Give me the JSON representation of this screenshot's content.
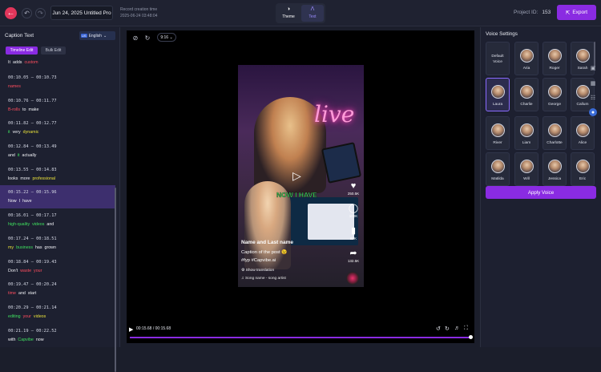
{
  "topbar": {
    "project_title": "Jun 24, 2025 Untitled Pro",
    "record_label": "Record creation time",
    "record_time": "2025-06-24 03:48:04",
    "modes": [
      {
        "label": "Theme"
      },
      {
        "label": "Text"
      }
    ],
    "project_id_label": "Project ID:",
    "project_id": "153",
    "export_label": "Export"
  },
  "left": {
    "title": "Caption Text",
    "language": {
      "flag": "US",
      "label": "English"
    },
    "tabs": [
      {
        "label": "Timeline Edit"
      },
      {
        "label": "Bulk Edit"
      }
    ],
    "first_partial": [
      {
        "t": "It",
        "c": "w"
      },
      {
        "t": "adds",
        "c": "w"
      },
      {
        "t": "custom",
        "c": "r"
      }
    ],
    "captions": [
      {
        "time": "00:10.05 – 00:10.73",
        "words": [
          {
            "t": "names",
            "c": "r"
          }
        ]
      },
      {
        "time": "00:10.76 – 00:11.77",
        "words": [
          {
            "t": "B-rolls",
            "c": "r"
          },
          {
            "t": "to",
            "c": "w"
          },
          {
            "t": "make",
            "c": "w"
          }
        ]
      },
      {
        "time": "00:11.82 – 00:12.77",
        "words": [
          {
            "t": "it",
            "c": "g"
          },
          {
            "t": "very",
            "c": "w"
          },
          {
            "t": "dynamic",
            "c": "y"
          }
        ]
      },
      {
        "time": "00:12.84 – 00:13.49",
        "words": [
          {
            "t": "and",
            "c": "w"
          },
          {
            "t": "it",
            "c": "g"
          },
          {
            "t": "actually",
            "c": "w"
          }
        ]
      },
      {
        "time": "00:13.55 – 00:14.83",
        "words": [
          {
            "t": "looks",
            "c": "w"
          },
          {
            "t": "more",
            "c": "w"
          },
          {
            "t": "professional",
            "c": "y"
          }
        ]
      },
      {
        "time": "00:15.22 – 00:15.96",
        "words": [
          {
            "t": "Now",
            "c": "w"
          },
          {
            "t": "I",
            "c": "w"
          },
          {
            "t": "have",
            "c": "w"
          }
        ],
        "active": true
      },
      {
        "time": "00:16.01 – 00:17.17",
        "words": [
          {
            "t": "high-quality",
            "c": "g"
          },
          {
            "t": "videos",
            "c": "g"
          },
          {
            "t": "and",
            "c": "w"
          }
        ]
      },
      {
        "time": "00:17.24 – 00:18.51",
        "words": [
          {
            "t": "my",
            "c": "y"
          },
          {
            "t": "business",
            "c": "g"
          },
          {
            "t": "has",
            "c": "w"
          },
          {
            "t": "grown",
            "c": "w"
          }
        ]
      },
      {
        "time": "00:18.84 – 00:19.43",
        "words": [
          {
            "t": "Don't",
            "c": "w"
          },
          {
            "t": "waste",
            "c": "r"
          },
          {
            "t": "your",
            "c": "r"
          }
        ]
      },
      {
        "time": "00:19.47 – 00:20.24",
        "words": [
          {
            "t": "time",
            "c": "r"
          },
          {
            "t": "and",
            "c": "w"
          },
          {
            "t": "start",
            "c": "w"
          }
        ]
      },
      {
        "time": "00:20.29 – 00:21.14",
        "words": [
          {
            "t": "editing",
            "c": "g"
          },
          {
            "t": "your",
            "c": "r"
          },
          {
            "t": "videos",
            "c": "y"
          }
        ]
      },
      {
        "time": "00:21.19 – 00:22.52",
        "words": [
          {
            "t": "with",
            "c": "w"
          },
          {
            "t": "Capvibe",
            "c": "g"
          },
          {
            "t": "now",
            "c": "w"
          }
        ]
      }
    ]
  },
  "player": {
    "ratio": "9:16",
    "caption_overlay": "NOW I HAVE",
    "author": "Name and Last name",
    "post_caption": "Caption of the post 😉",
    "hashtags": "#fyp #Capvibe.ai",
    "show_translation": "Show translation",
    "song": "Song name - song artist",
    "likes": "250.5K",
    "comments": "100K",
    "saves": "89K",
    "shares": "132.5K",
    "time": "00:15.68 / 00:15.68",
    "progress": 1.0
  },
  "voice": {
    "title": "Voice Settings",
    "voices": [
      {
        "name": "Default Voice"
      },
      {
        "name": "Aria"
      },
      {
        "name": "Roger"
      },
      {
        "name": "Sarah"
      },
      {
        "name": "Laura",
        "selected": true
      },
      {
        "name": "Charlie"
      },
      {
        "name": "George"
      },
      {
        "name": "Callum"
      },
      {
        "name": "River"
      },
      {
        "name": "Liam"
      },
      {
        "name": "Charlotte"
      },
      {
        "name": "Alice"
      },
      {
        "name": "Matilda"
      },
      {
        "name": "Will"
      },
      {
        "name": "Jessica"
      },
      {
        "name": "Eric"
      }
    ],
    "apply_label": "Apply Voice"
  },
  "colors": {
    "accent": "#8a2be2",
    "active_row": "#3d2f6e",
    "red": "#ff4d5e",
    "yellow": "#e8e03a",
    "green": "#3fe05f"
  }
}
